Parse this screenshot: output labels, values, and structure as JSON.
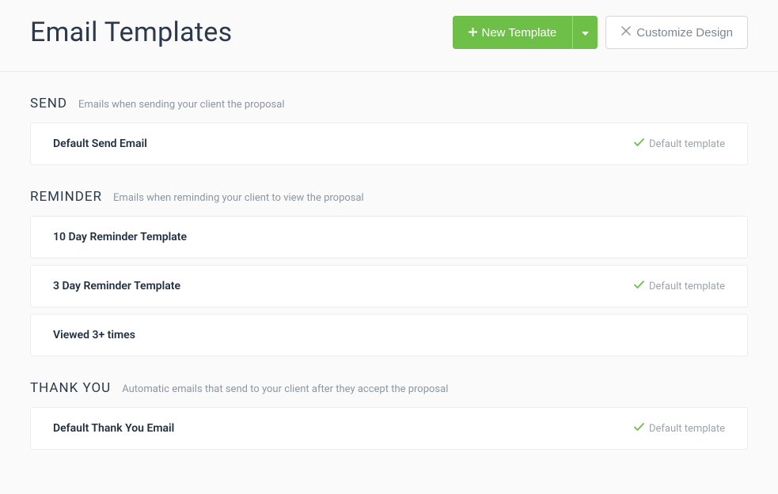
{
  "header": {
    "title": "Email Templates",
    "new_template_label": "New Template",
    "customize_design_label": "Customize Design"
  },
  "sections": {
    "send": {
      "title": "SEND",
      "desc": "Emails when sending your client the proposal",
      "items": [
        {
          "name": "Default Send Email",
          "default": true
        }
      ]
    },
    "reminder": {
      "title": "REMINDER",
      "desc": "Emails when reminding your client to view the proposal",
      "items": [
        {
          "name": "10 Day Reminder Template",
          "default": false
        },
        {
          "name": "3 Day Reminder Template",
          "default": true
        },
        {
          "name": "Viewed 3+ times",
          "default": false
        }
      ]
    },
    "thankyou": {
      "title": "THANK YOU",
      "desc": "Automatic emails that send to your client after they accept the proposal",
      "items": [
        {
          "name": "Default Thank You Email",
          "default": true
        }
      ]
    }
  },
  "default_template_label": "Default template"
}
